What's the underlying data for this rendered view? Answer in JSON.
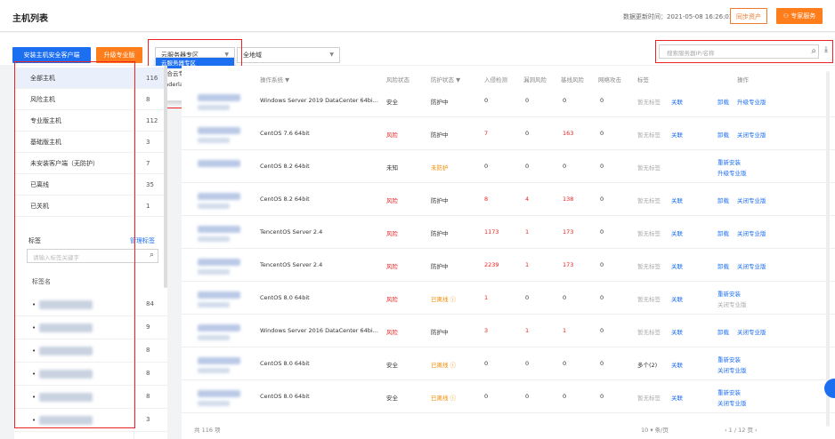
{
  "header": {
    "title": "主机列表",
    "update_time": "数据更新时间：2021-05-08 16:26:03",
    "sync_button": "同步资产",
    "expert_button": "专家服务"
  },
  "toolbar": {
    "install_button": "安装主机安全客户端",
    "upgrade_button": "升级专业版",
    "zone_select": "云服务器专区",
    "region_select": "全地域",
    "search_placeholder": "搜索服务器IP/名称"
  },
  "zone_dropdown": {
    "options": [
      "云服务器专区",
      "混合云专区",
      "underlay专区"
    ],
    "selected": "云服务器专区"
  },
  "sidebar": {
    "items": [
      {
        "label": "全部主机",
        "count": "116"
      },
      {
        "label": "风险主机",
        "count": "8"
      },
      {
        "label": "专业版主机",
        "count": "112"
      },
      {
        "label": "基础版主机",
        "count": "3"
      },
      {
        "label": "未安装客户端（无防护）",
        "count": "7"
      },
      {
        "label": "已离线",
        "count": "35"
      },
      {
        "label": "已关机",
        "count": "1"
      }
    ],
    "tags_label": "标签",
    "manage_tags": "管理标签",
    "tag_search_placeholder": "请输入标签关键字",
    "tag_name_header": "标签名",
    "tags": [
      {
        "bullet": "•",
        "count": "84"
      },
      {
        "bullet": "•",
        "count": "9"
      },
      {
        "bullet": "•",
        "count": "8"
      },
      {
        "bullet": "•",
        "count": "8"
      },
      {
        "bullet": "•",
        "count": "8"
      },
      {
        "bullet": "•",
        "count": "3"
      }
    ]
  },
  "table": {
    "headers": {
      "os": "操作系统 ▼",
      "risk": "风险状态",
      "protect": "防护状态 ▼",
      "intrusion": "入侵检测",
      "vuln": "漏洞风险",
      "baseline": "基线风险",
      "attack": "网络攻击",
      "tags": "标签",
      "ops": "操作"
    },
    "rows": [
      {
        "os": "Windows Server 2019 DataCenter 64bi...",
        "risk": "安全",
        "protect": "防护中",
        "intrusion": "0",
        "vuln": "0",
        "baseline": "0",
        "attack": "0",
        "tags": "暂无标签",
        "tag_link": "关联",
        "op1": "卸载",
        "op2": "升级专业版"
      },
      {
        "os": "CentOS 7.6 64bit",
        "risk": "风险",
        "protect": "防护中",
        "intrusion": "7",
        "vuln": "0",
        "baseline": "163",
        "attack": "0",
        "tags": "暂无标签",
        "tag_link": "关联",
        "op1": "卸载",
        "op2": "关闭专业版"
      },
      {
        "os": "CentOS 8.2 64bit",
        "risk": "未知",
        "protect": "未防护",
        "intrusion": "0",
        "vuln": "0",
        "baseline": "0",
        "attack": "0",
        "tags": "暂无标签",
        "tag_link": "",
        "op1": "重新安装",
        "op2": "升级专业版"
      },
      {
        "os": "CentOS 8.2 64bit",
        "risk": "风险",
        "protect": "防护中",
        "intrusion": "8",
        "vuln": "4",
        "baseline": "138",
        "attack": "0",
        "tags": "暂无标签",
        "tag_link": "关联",
        "op1": "卸载",
        "op2": "关闭专业版"
      },
      {
        "os": "TencentOS Server 2.4",
        "risk": "风险",
        "protect": "防护中",
        "intrusion": "1173",
        "vuln": "1",
        "baseline": "173",
        "attack": "0",
        "tags": "暂无标签",
        "tag_link": "关联",
        "op1": "卸载",
        "op2": "关闭专业版"
      },
      {
        "os": "TencentOS Server 2.4",
        "risk": "风险",
        "protect": "防护中",
        "intrusion": "2239",
        "vuln": "1",
        "baseline": "173",
        "attack": "0",
        "tags": "暂无标签",
        "tag_link": "关联",
        "op1": "卸载",
        "op2": "关闭专业版"
      },
      {
        "os": "CentOS 8.0 64bit",
        "risk": "风险",
        "protect": "已离线 ⓘ",
        "intrusion": "1",
        "vuln": "0",
        "baseline": "0",
        "attack": "0",
        "tags": "暂无标签",
        "tag_link": "关联",
        "op1": "重新安装",
        "op2": "关闭专业版"
      },
      {
        "os": "Windows Server 2016 DataCenter 64bi...",
        "risk": "风险",
        "protect": "防护中",
        "intrusion": "3",
        "vuln": "1",
        "baseline": "1",
        "attack": "0",
        "tags": "暂无标签",
        "tag_link": "关联",
        "op1": "卸载",
        "op2": "关闭专业版"
      },
      {
        "os": "CentOS 8.0 64bit",
        "risk": "安全",
        "protect": "已离线 ⓘ",
        "intrusion": "0",
        "vuln": "0",
        "baseline": "0",
        "attack": "0",
        "tags": "多个(2)",
        "tag_link": "关联",
        "op1": "重新安装",
        "op2": "关闭专业版"
      },
      {
        "os": "CentOS 8.0 64bit",
        "risk": "安全",
        "protect": "已离线 ⓘ",
        "intrusion": "0",
        "vuln": "0",
        "baseline": "0",
        "attack": "0",
        "tags": "暂无标签",
        "tag_link": "关联",
        "op1": "重新安装",
        "op2": "关闭专业版"
      }
    ]
  },
  "pager": {
    "total": "共 116 项",
    "page_size": "10 ▾ 条/页",
    "pages": "‹  1  / 12 页  ›"
  },
  "colors": {
    "accent_blue": "#1d6ff2",
    "accent_orange": "#ff7d1a",
    "risk_red": "#e22",
    "highlight_box": "#e22"
  }
}
